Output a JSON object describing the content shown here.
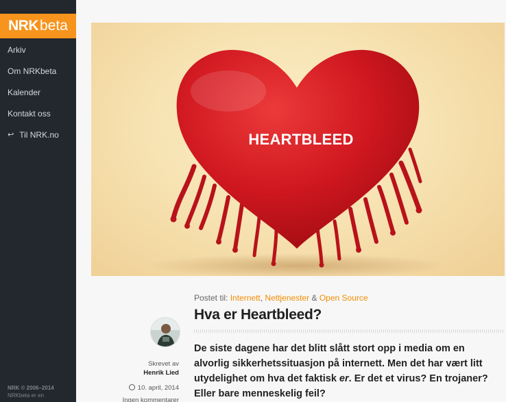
{
  "sidebar": {
    "logo": {
      "nrk": "NRK",
      "beta": "beta"
    },
    "items": [
      {
        "label": "Arkiv"
      },
      {
        "label": "Om NRKbeta"
      },
      {
        "label": "Kalender"
      },
      {
        "label": "Kontakt oss"
      },
      {
        "label": "Til NRK.no",
        "icon": "return-arrow-icon"
      }
    ],
    "footer": {
      "copyright": "NRK © 2006–2014",
      "line2": "NRKbeta er en"
    }
  },
  "article": {
    "hero_text": "HEARTBLEED",
    "posted_prefix": "Postet til:",
    "categories": [
      "Internett",
      "Nettjenester",
      "Open Source"
    ],
    "sep1": ",",
    "sep2": "&",
    "title": "Hva er Heartbleed?",
    "lead_a": "De siste dagene har det blitt slått stort opp i media om en alvorlig sikkerhetssituasjon på internett. Men det har vært litt utydelighet om hva det faktisk ",
    "lead_em": "er",
    "lead_b": ". Er det et virus? En trojaner? Eller bare menneskelig feil?",
    "author_label": "Skrevet av",
    "author_name": "Henrik Lied",
    "date": "10. april, 2014",
    "comments": "Ingen kommentarer"
  },
  "colors": {
    "accent": "#f7941d",
    "sidebar": "#23272e",
    "heart": "#d2171f"
  }
}
